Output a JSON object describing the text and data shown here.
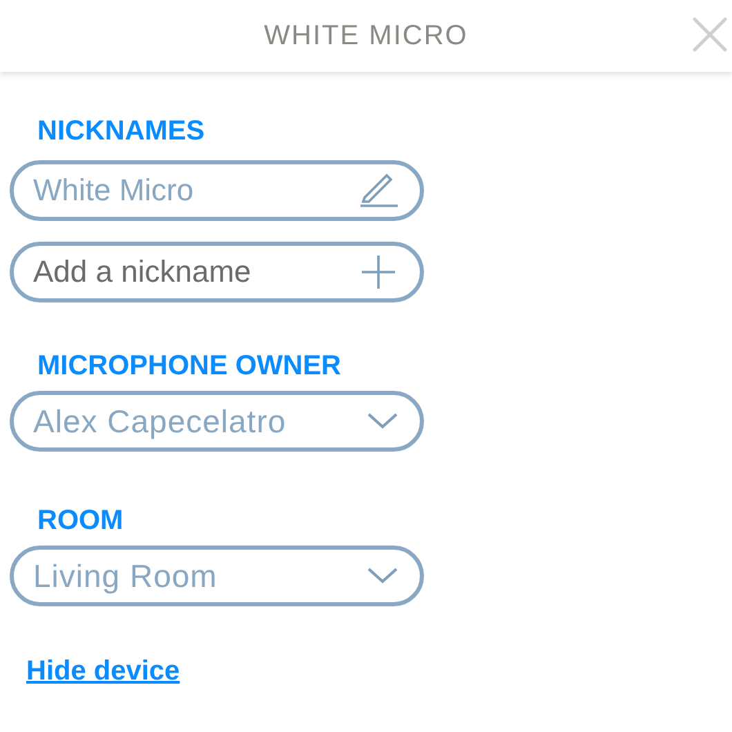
{
  "header": {
    "title": "WHITE MICRO"
  },
  "nicknames": {
    "label": "NICKNAMES",
    "items": [
      {
        "value": "White Micro"
      }
    ],
    "add_placeholder": "Add a nickname"
  },
  "owner": {
    "label": "MICROPHONE OWNER",
    "value": "Alex Capecelatro"
  },
  "room": {
    "label": "ROOM",
    "value": "Living Room"
  },
  "hide_link": "Hide device"
}
